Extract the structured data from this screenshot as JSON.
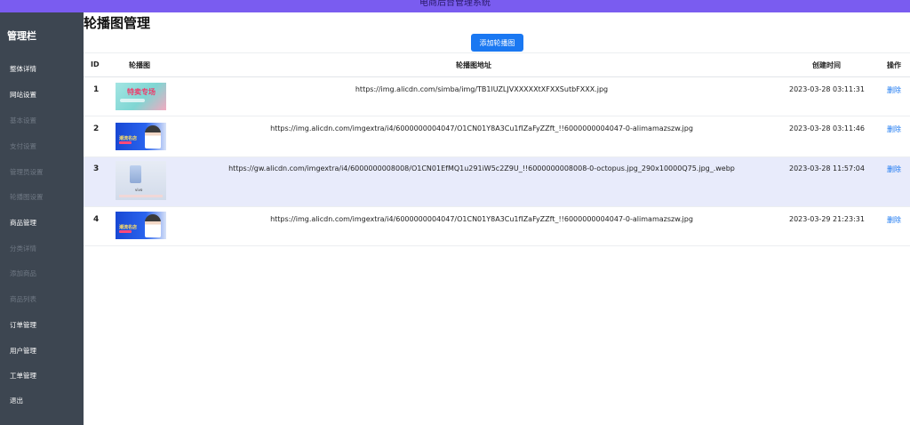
{
  "window": {
    "title": "电商后台管理系统"
  },
  "sidebar": {
    "title": "管理栏",
    "items": [
      {
        "label": "整体详情",
        "enabled": true
      },
      {
        "label": "网站设置",
        "enabled": true
      },
      {
        "label": "基本设置",
        "enabled": false
      },
      {
        "label": "支付设置",
        "enabled": false
      },
      {
        "label": "管理员设置",
        "enabled": false
      },
      {
        "label": "轮播图设置",
        "enabled": false
      },
      {
        "label": "商品管理",
        "enabled": true
      },
      {
        "label": "分类详情",
        "enabled": false
      },
      {
        "label": "添加商品",
        "enabled": false
      },
      {
        "label": "商品列表",
        "enabled": false
      },
      {
        "label": "订单管理",
        "enabled": true
      },
      {
        "label": "用户管理",
        "enabled": true
      },
      {
        "label": "工单管理",
        "enabled": true
      },
      {
        "label": "退出",
        "enabled": true
      }
    ]
  },
  "main": {
    "page_title": "轮播图管理",
    "add_button": "添加轮播图",
    "columns": {
      "id": "ID",
      "image": "轮播图",
      "url": "轮播图地址",
      "created": "创建时间",
      "action": "操作"
    },
    "rows": [
      {
        "id": "1",
        "url": "https://img.alicdn.com/simba/img/TB1lUZLJVXXXXXtXFXXSutbFXXX.jpg",
        "created": "2023-03-28 03:11:31",
        "action": "删除",
        "thumb": "teal",
        "thumb_text": "特卖专场",
        "highlight": false
      },
      {
        "id": "2",
        "url": "https://img.alicdn.com/imgextra/i4/6000000004047/O1CN01Y8A3Cu1fIZaFyZZft_!!6000000004047-0-alimamazszw.jpg",
        "created": "2023-03-28 03:11:46",
        "action": "删除",
        "thumb": "blue",
        "thumb_text": "潮流名店",
        "highlight": false
      },
      {
        "id": "3",
        "url": "https://gw.alicdn.com/imgextra/i4/6000000008008/O1CN01EfMQ1u291iW5c2Z9U_!!6000000008008-0-octopus.jpg_290x10000Q75.jpg_.webp",
        "created": "2023-03-28 11:57:04",
        "action": "删除",
        "thumb": "vivo",
        "thumb_text": "vivo",
        "highlight": true
      },
      {
        "id": "4",
        "url": "https://img.alicdn.com/imgextra/i4/6000000004047/O1CN01Y8A3Cu1fIZaFyZZft_!!6000000004047-0-alimamazszw.jpg",
        "created": "2023-03-29 21:23:31",
        "action": "删除",
        "thumb": "blue",
        "thumb_text": "潮流名店",
        "highlight": false
      }
    ]
  },
  "colors": {
    "accent": "#1a78f2",
    "sidebar": "#3d4651",
    "topbar": "#7a5cf0",
    "row_highlight": "#e8ebfb"
  }
}
